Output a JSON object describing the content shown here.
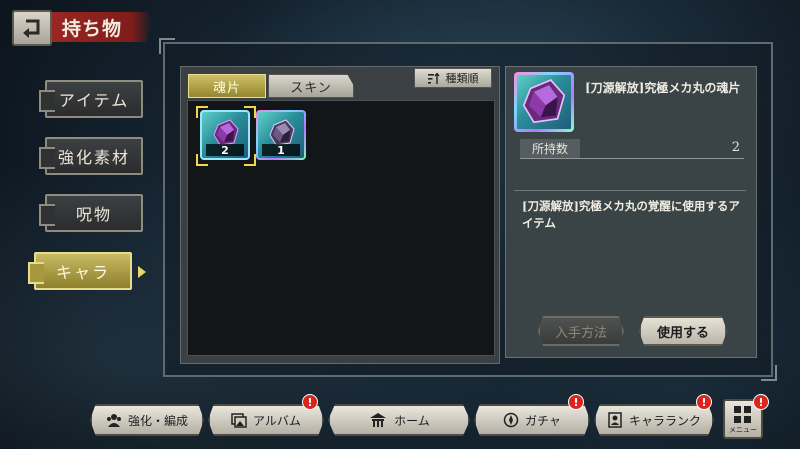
{
  "header": {
    "title": "持ち物",
    "back_icon": "back-arrow-icon"
  },
  "side_tabs": [
    {
      "label": "アイテム",
      "active": false
    },
    {
      "label": "強化素材",
      "active": false
    },
    {
      "label": "呪物",
      "active": false
    },
    {
      "label": "キャラ",
      "active": true
    }
  ],
  "sub_tabs": [
    {
      "label": "魂片",
      "active": true
    },
    {
      "label": "スキン",
      "active": false
    }
  ],
  "sort": {
    "label": "種類順",
    "icon": "sort-icon"
  },
  "items": [
    {
      "count": "2",
      "selected": true
    },
    {
      "count": "1",
      "selected": false
    }
  ],
  "detail": {
    "name": "[刀源解放]究極メカ丸の魂片",
    "own_label": "所持数",
    "own_value": "2",
    "description": "[刀源解放]究極メカ丸の覚醒に使用するアイテム",
    "get_button": "入手方法",
    "use_button": "使用する"
  },
  "bottom_nav": [
    {
      "label": "強化・編成",
      "icon": "team-icon",
      "badge": false
    },
    {
      "label": "アルバム",
      "icon": "album-icon",
      "badge": true
    },
    {
      "label": "ホーム",
      "icon": "home-icon",
      "badge": false
    },
    {
      "label": "ガチャ",
      "icon": "gacha-icon",
      "badge": true
    },
    {
      "label": "キャラランク",
      "icon": "rank-icon",
      "badge": true
    }
  ],
  "menu": {
    "label": "メニュー",
    "badge": true
  },
  "badge_glyph": "!",
  "colors": {
    "accent_gold": "#c9bb62",
    "badge_red": "#d8261f",
    "title_red": "#9a2623"
  }
}
